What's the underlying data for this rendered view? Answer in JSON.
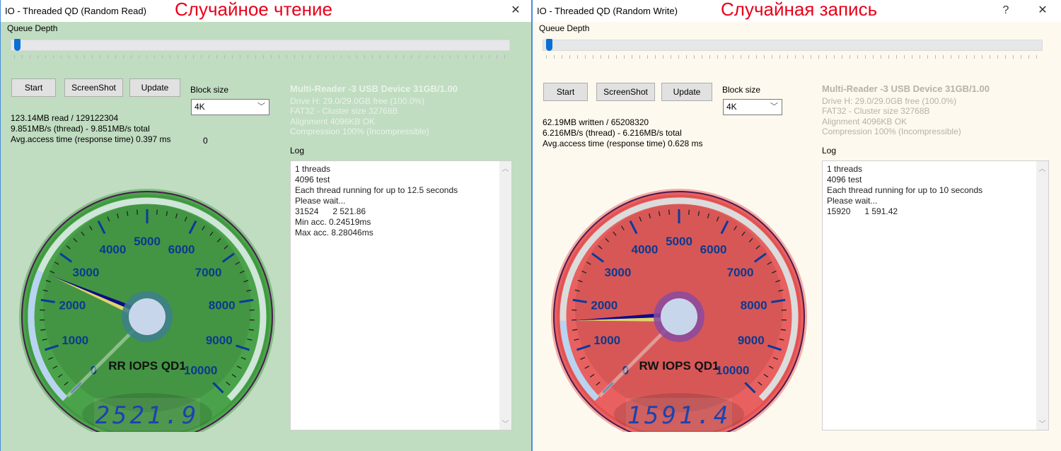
{
  "windows": [
    {
      "title": "IO - Threaded QD (Random Read)",
      "annotation": "Случайное чтение",
      "titlebar_buttons": [
        {
          "icon": "close-icon",
          "glyph": "✕"
        }
      ],
      "queue_depth": {
        "label": "Queue Depth",
        "value_fraction": 0.0
      },
      "buttons": {
        "start": "Start",
        "screenshot": "ScreenShot",
        "update": "Update"
      },
      "block_size": {
        "label": "Block size",
        "value": "4K"
      },
      "stats": [
        "123.14MB read / 129122304",
        "9.851MB/s (thread) - 9.851MB/s total",
        "Avg.access time (response time) 0.397 ms"
      ],
      "extra_value": "0",
      "device": {
        "title": "Multi-Reader  -3 USB Device 31GB/1.00",
        "lines": [
          "Drive H: 29.0/29.0GB free (100.0%)",
          "FAT32 - Cluster size 32768B",
          "Alignment 4096KB OK",
          "Compression 100% (Incompressible)"
        ]
      },
      "log": {
        "label": "Log",
        "lines": [
          "1 threads",
          "4096 test",
          "Each thread running for up to 12.5 seconds",
          "Please wait...",
          "31524      2 521.86",
          "Min acc. 0.24519ms",
          "Max acc. 8.28046ms"
        ]
      },
      "gauge": {
        "title": "RR IOPS QD1",
        "value": 2521.86,
        "display": "2521.9",
        "min": 0,
        "max": 10000,
        "labels": [
          "0",
          "1000",
          "2000",
          "3000",
          "4000",
          "5000",
          "6000",
          "7000",
          "8000",
          "9000",
          "10000"
        ],
        "face_color": "#4aa34a",
        "face_inner_color": "#3e8a3e",
        "rim_color": "#3f9a3f",
        "hub_ring_color": "#3d7f8c",
        "arc_color": "#cfe6d8"
      }
    },
    {
      "title": "IO - Threaded QD (Random Write)",
      "annotation": "Случайная запись",
      "titlebar_buttons": [
        {
          "icon": "help-icon",
          "glyph": "?"
        },
        {
          "icon": "close-icon",
          "glyph": "✕"
        }
      ],
      "queue_depth": {
        "label": "Queue Depth",
        "value_fraction": 0.0
      },
      "buttons": {
        "start": "Start",
        "screenshot": "ScreenShot",
        "update": "Update"
      },
      "block_size": {
        "label": "Block size",
        "value": "4K"
      },
      "stats": [
        "62.19MB written / 65208320",
        "6.216MB/s (thread) - 6.216MB/s total",
        "Avg.access time (response time) 0.628 ms"
      ],
      "extra_value": "",
      "device": {
        "title": "Multi-Reader  -3 USB Device 31GB/1.00",
        "lines": [
          "Drive H: 29.0/29.0GB free (100.0%)",
          "FAT32 - Cluster size 32768B",
          "Alignment 4096KB OK",
          "Compression 100% (Incompressible)"
        ]
      },
      "log": {
        "label": "Log",
        "lines": [
          "1 threads",
          "4096 test",
          "Each thread running for up to 10 seconds",
          "Please wait...",
          "15920      1 591.42"
        ]
      },
      "gauge": {
        "title": "RW IOPS QD1",
        "value": 1591.42,
        "display": "1591.4",
        "min": 0,
        "max": 10000,
        "labels": [
          "0",
          "1000",
          "2000",
          "3000",
          "4000",
          "5000",
          "6000",
          "7000",
          "8000",
          "9000",
          "10000"
        ],
        "face_color": "#e86060",
        "face_inner_color": "#c85050",
        "rim_color": "#e35050",
        "hub_ring_color": "#8a4aa0",
        "arc_color": "#dcdcdc"
      }
    }
  ]
}
